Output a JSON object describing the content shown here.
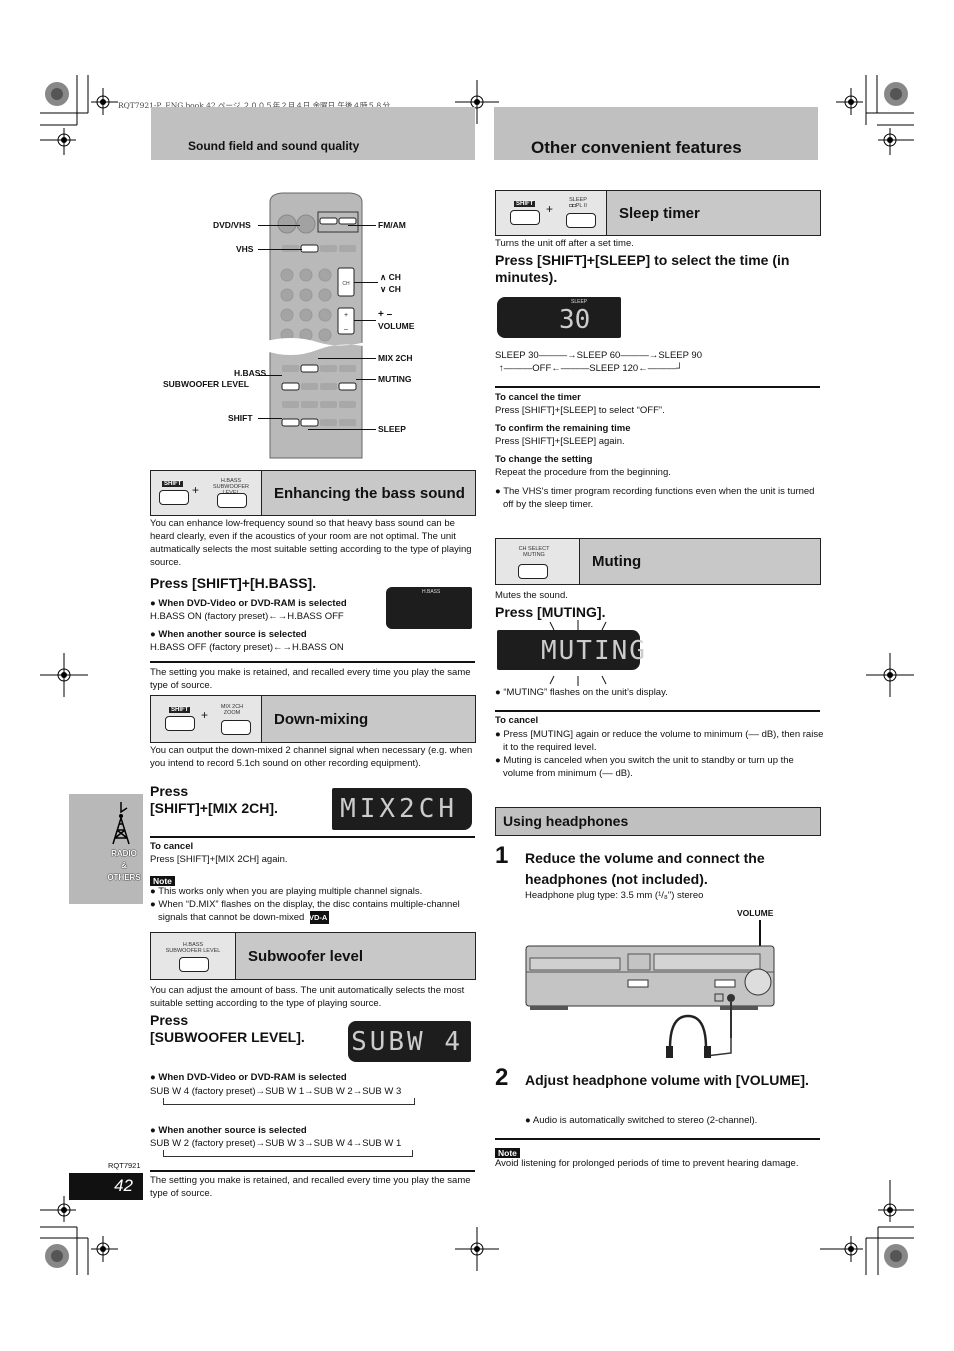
{
  "print_header": "RQT7921-P_ENG.book  42 ページ  ２００５年２月４日  金曜日  午後４時５８分",
  "left": {
    "band_title": "Sound field and sound quality",
    "remote_callouts": {
      "dvd_vhs": "DVD/VHS",
      "fm_am": "FM/AM",
      "vhs": "VHS",
      "ch_up": "CH",
      "ch_down": "CH",
      "vol_sym": "+ –",
      "volume": "VOLUME",
      "mix2ch": "MIX 2CH",
      "hbass_1": "H.BASS",
      "hbass_2": "SUBWOOFER LEVEL",
      "muting": "MUTING",
      "shift": "SHIFT",
      "sleep": "SLEEP"
    },
    "bass": {
      "btn_shift": "SHIFT",
      "btn_plus": "+",
      "btn_label": "H.BASS SUBWOOFER LEVEL",
      "title": "Enhancing the bass sound",
      "intro": "You can enhance low-frequency sound so that heavy bass sound can be heard clearly, even if the acoustics of your room are not optimal. The unit autmatically selects the most suitable setting according to the type of playing source.",
      "press": "Press [SHIFT]+[H.BASS].",
      "lcd_label": "H.BASS",
      "case1_head": "When DVD-Video or DVD-RAM is selected",
      "case1_text": "H.BASS ON (factory preset)←→H.BASS OFF",
      "case2_head": "When another source is selected",
      "case2_text": "H.BASS OFF (factory preset)←→H.BASS ON",
      "retained": "The setting you make is retained, and recalled every time you play the same type of source."
    },
    "downmix": {
      "btn_shift": "SHIFT",
      "btn_plus": "+",
      "btn_label": "MIX 2CH ZOOM",
      "title": "Down-mixing",
      "intro": "You can output the down-mixed 2 channel signal when necessary (e.g. when you intend to record 5.1ch sound on other recording equipment).",
      "press_1": "Press",
      "press_2": "[SHIFT]+[MIX 2CH].",
      "lcd_text": "MIX2CH",
      "cancel_head": "To cancel",
      "cancel_text": "Press [SHIFT]+[MIX 2CH] again.",
      "note_label": "Note",
      "note_1": "This works only when you are playing multiple channel signals.",
      "note_2": "When “D.MIX” flashes on the display, the disc contains multiple-channel signals that cannot be down-mixed.",
      "note_badge": "DVD-A"
    },
    "subwoofer": {
      "btn_label": "H.BASS SUBWOOFER LEVEL",
      "title": "Subwoofer level",
      "intro": "You can adjust the amount of bass. The unit automatically selects the most suitable setting according to the type of playing source.",
      "press_1": "Press",
      "press_2": "[SUBWOOFER LEVEL].",
      "lcd_text": "SUBW 4",
      "case1_head": "When DVD-Video or DVD-RAM is selected",
      "case1_text": "SUB W 4 (factory preset)→SUB W 1→SUB W 2→SUB W 3",
      "case2_head": "When another source is selected",
      "case2_text": "SUB W 2 (factory preset)→SUB W 3→SUB W 4→SUB W 1",
      "retained": "The setting you make is retained, and recalled every time you play the same type of source."
    },
    "side_tab": {
      "line1": "RADIO",
      "line2": "&",
      "line3": "OTHERS"
    },
    "model_code": "RQT7921",
    "page_number": "42"
  },
  "right": {
    "band_title": "Other convenient features",
    "sleep": {
      "btn_shift": "SHIFT",
      "btn_plus": "+",
      "btn_label": "SLEEP ◘◘PL II",
      "title": "Sleep timer",
      "intro": "Turns the unit off after a set time.",
      "press": "Press [SHIFT]+[SLEEP] to select the time (in minutes).",
      "lcd_label": "SLEEP",
      "lcd_value": "30",
      "cycle_line1": "SLEEP 30———→SLEEP 60———→SLEEP 90",
      "cycle_line2": "↑———OFF←———SLEEP 120←———┘",
      "cancel_head": "To cancel the timer",
      "cancel_text": "Press [SHIFT]+[SLEEP] to select “OFF”.",
      "confirm_head": "To confirm the remaining time",
      "confirm_text": "Press [SHIFT]+[SLEEP] again.",
      "change_head": "To change the setting",
      "change_text": "Repeat the procedure from the beginning.",
      "bullet": "The VHS's timer program recording functions even when the unit is turned off by the sleep timer."
    },
    "muting": {
      "btn_label": "CH SELECT MUTING",
      "title": "Muting",
      "intro": "Mutes the sound.",
      "press": "Press [MUTING].",
      "lcd_text": "MUTING",
      "flash_note": "“MUTING” flashes on the unit’s display.",
      "cancel_head": "To cancel",
      "cancel_1": "Press [MUTING] again or reduce the volume to minimum (–– dB), then raise it to the required level.",
      "cancel_2": "Muting is canceled when you switch the unit to standby or turn up the volume from minimum (–– dB)."
    },
    "headphones": {
      "title": "Using headphones",
      "step1_num": "1",
      "step1_text": "Reduce the volume and connect the headphones (not included).",
      "step1_sub": "Headphone plug type:  3.5 mm (¹/₈\") stereo",
      "volume_callout": "VOLUME",
      "step2_num": "2",
      "step2_text": "Adjust headphone volume with [VOLUME].",
      "step2_sub": "Audio is automatically switched to stereo (2-channel).",
      "note_label": "Note",
      "note_text": "Avoid listening for prolonged periods of time to prevent hearing damage."
    }
  }
}
